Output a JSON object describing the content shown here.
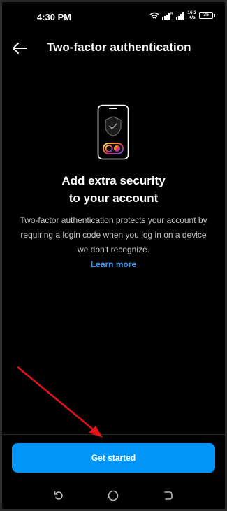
{
  "status_bar": {
    "time": "4:30 PM",
    "speed_value": "16.3",
    "speed_unit": "K/s",
    "battery": "35"
  },
  "header": {
    "title": "Two-factor authentication",
    "back_icon": "arrow-left-icon"
  },
  "illustration": {
    "icon": "phone-shield-check-icon"
  },
  "content": {
    "headline_line1": "Add extra security",
    "headline_line2": "to your account",
    "description": "Two-factor authentication protects your account by requiring a login code when you log in on a device we don't recognize.",
    "learn_more": "Learn more"
  },
  "cta": {
    "label": "Get started"
  },
  "nav_bar": {
    "items": [
      "recents-icon",
      "home-icon",
      "back-icon"
    ]
  },
  "colors": {
    "background": "#000000",
    "accent": "#0095f6",
    "link": "#3897f0",
    "annotation_arrow": "#e3131b"
  }
}
